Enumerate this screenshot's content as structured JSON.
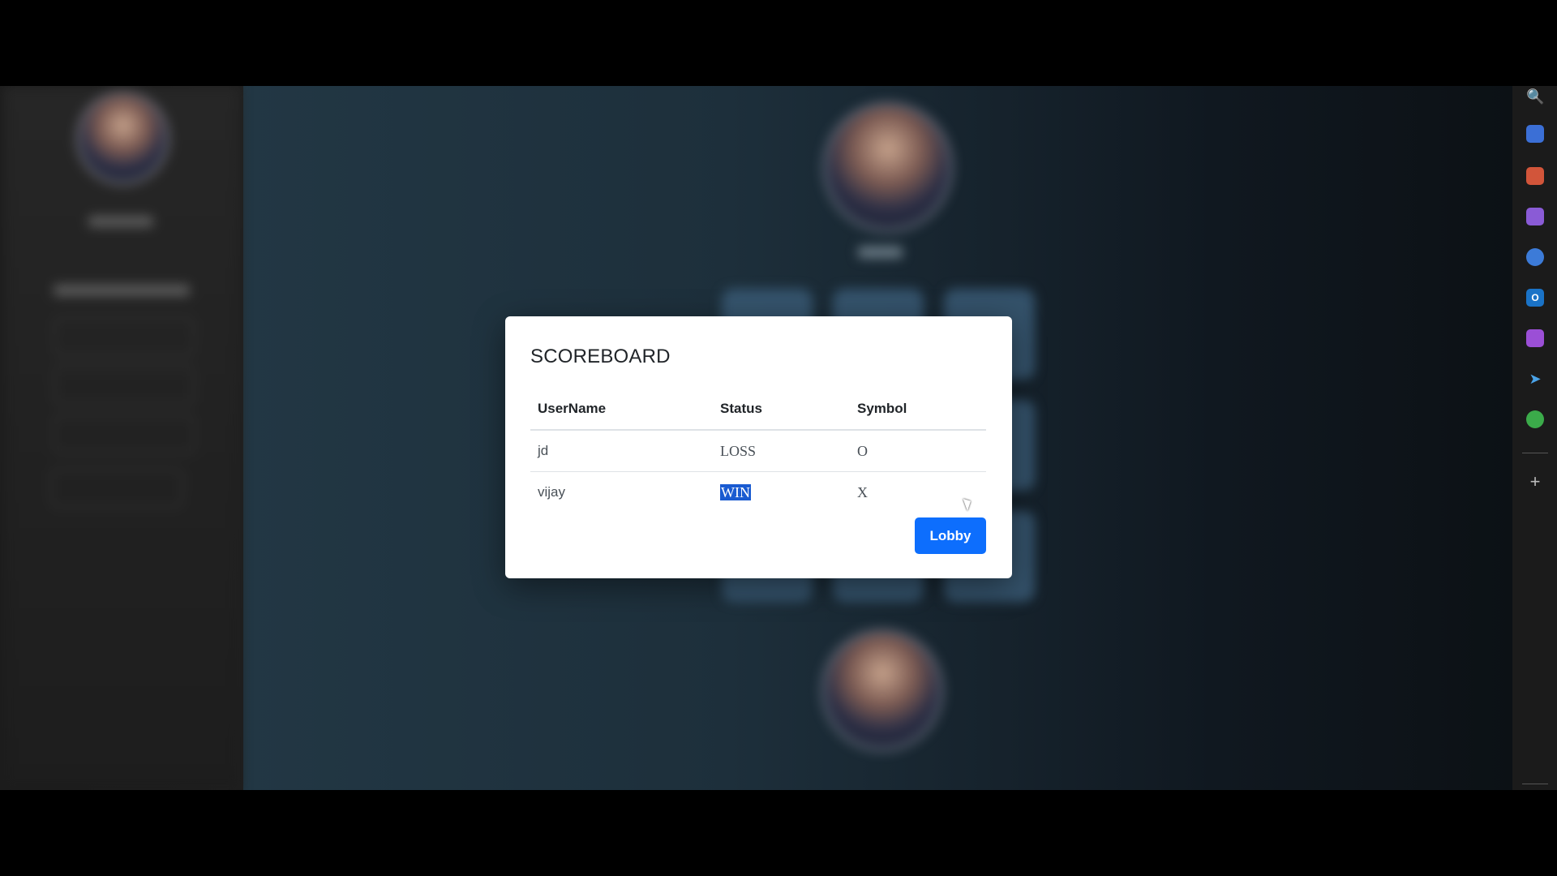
{
  "modal": {
    "title": "SCOREBOARD",
    "columns": [
      "UserName",
      "Status",
      "Symbol"
    ],
    "rows": [
      {
        "username": "jd",
        "status": "LOSS",
        "symbol": "O"
      },
      {
        "username": "vijay",
        "status": "WIN",
        "symbol": "X"
      }
    ],
    "lobby_label": "Lobby"
  },
  "sidebar": {
    "icons": [
      "search-icon",
      "tag-icon",
      "briefcase-icon",
      "games-icon",
      "copilot-icon",
      "outlook-icon",
      "designer-icon",
      "send-icon",
      "tree-icon",
      "add-icon"
    ]
  },
  "colors": {
    "primary": "#0d6efd",
    "selection": "#1a5bd1",
    "modal_bg": "#ffffff"
  }
}
